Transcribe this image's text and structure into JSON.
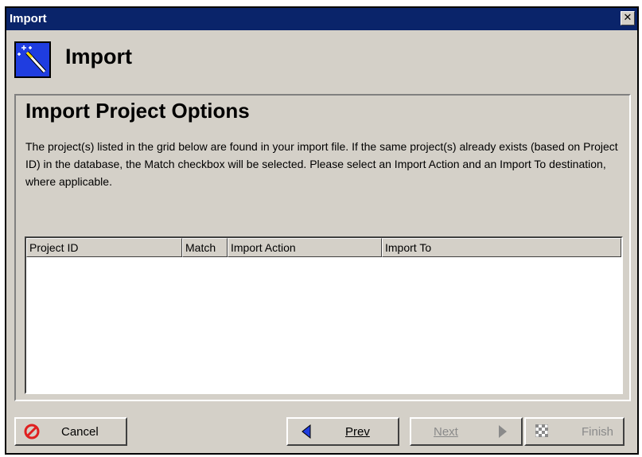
{
  "window": {
    "title": "Import",
    "close_label": "✕"
  },
  "header": {
    "title": "Import",
    "icon": "wizard-wand-icon"
  },
  "panel": {
    "title": "Import Project Options",
    "description": "The project(s) listed in the grid below are found in your import file. If the same project(s) already exists (based on Project ID) in the database, the Match checkbox will be selected.  Please select an Import Action and an Import To destination, where applicable."
  },
  "grid": {
    "columns": [
      "Project ID",
      "Match",
      "Import Action",
      "Import To"
    ],
    "rows": []
  },
  "buttons": {
    "cancel": {
      "label": "Cancel",
      "icon": "cancel-icon",
      "enabled": true
    },
    "prev": {
      "label": "Prev",
      "icon": "arrow-left-icon",
      "enabled": true
    },
    "next": {
      "label": "Next",
      "icon": "arrow-right-icon",
      "enabled": false
    },
    "finish": {
      "label": "Finish",
      "icon": "checkered-flag-icon",
      "enabled": false
    }
  },
  "colors": {
    "titlebar": "#0a246a",
    "icon_bg": "#1f3de0",
    "cancel_red": "#e02020",
    "prev_blue": "#1f3de0",
    "disabled_text": "#8a8a8a"
  }
}
